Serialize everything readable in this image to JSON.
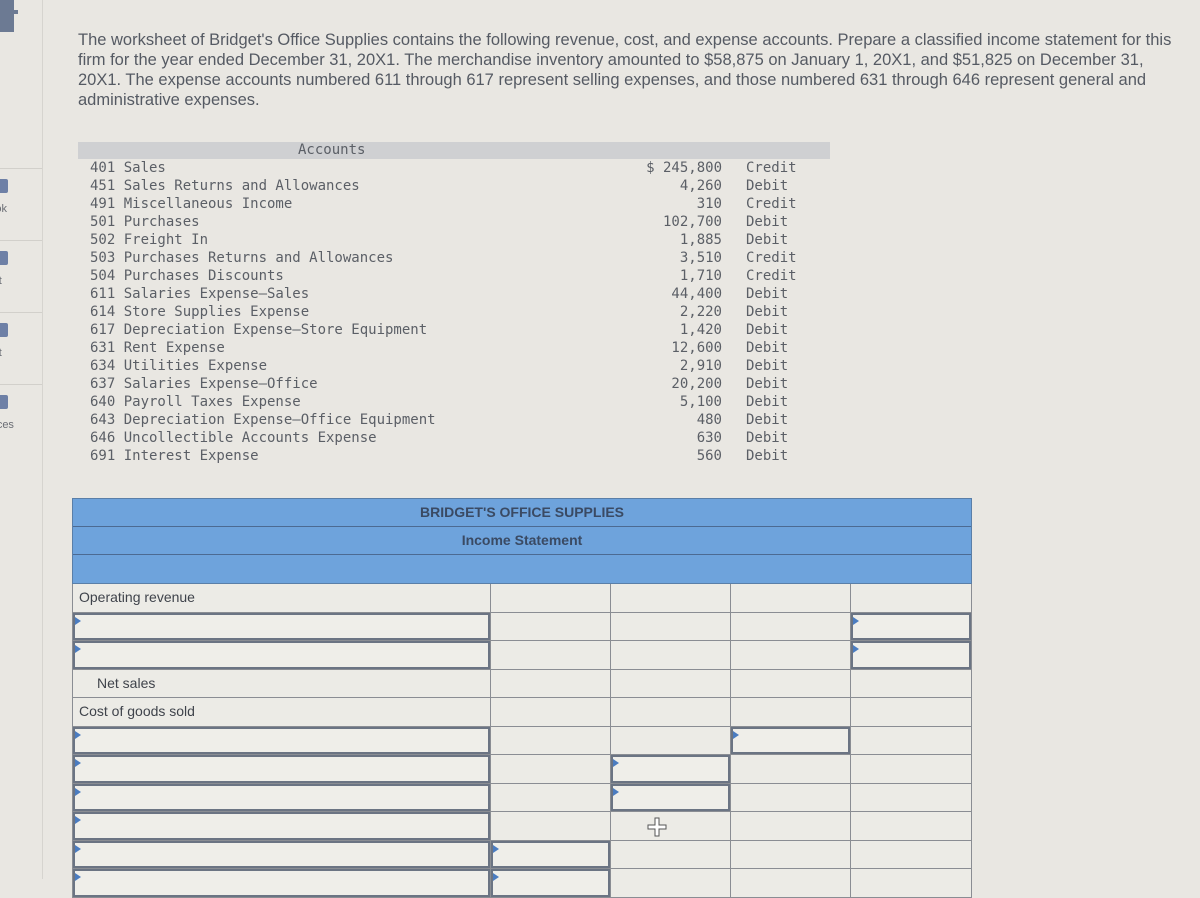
{
  "sidebar": {
    "items": [
      {
        "label": "ok",
        "icon": "book-icon"
      },
      {
        "label": "t",
        "icon": "print-icon"
      },
      {
        "label": "t",
        "icon": "hint-icon"
      },
      {
        "label": "nces",
        "icon": "references-icon"
      }
    ]
  },
  "prompt": "The worksheet of Bridget's Office Supplies contains the following revenue, cost, and expense accounts. Prepare a classified income statement for this firm for the year ended December 31, 20X1. The merchandise inventory amounted to $58,875 on January 1, 20X1, and $51,825 on December 31, 20X1. The expense accounts numbered 611 through 617 represent selling expenses, and those numbered 631 through 646 represent general and administrative expenses.",
  "accounts": {
    "header": "Accounts",
    "rows": [
      {
        "name": "401 Sales",
        "amount": "$ 245,800",
        "side": "Credit"
      },
      {
        "name": "451 Sales Returns and Allowances",
        "amount": "4,260",
        "side": "Debit"
      },
      {
        "name": "491 Miscellaneous Income",
        "amount": "310",
        "side": "Credit"
      },
      {
        "name": "501 Purchases",
        "amount": "102,700",
        "side": "Debit"
      },
      {
        "name": "502 Freight In",
        "amount": "1,885",
        "side": "Debit"
      },
      {
        "name": "503 Purchases Returns and Allowances",
        "amount": "3,510",
        "side": "Credit"
      },
      {
        "name": "504 Purchases Discounts",
        "amount": "1,710",
        "side": "Credit"
      },
      {
        "name": "611 Salaries Expense—Sales",
        "amount": "44,400",
        "side": "Debit"
      },
      {
        "name": "614 Store Supplies Expense",
        "amount": "2,220",
        "side": "Debit"
      },
      {
        "name": "617 Depreciation Expense—Store Equipment",
        "amount": "1,420",
        "side": "Debit"
      },
      {
        "name": "631 Rent Expense",
        "amount": "12,600",
        "side": "Debit"
      },
      {
        "name": "634 Utilities Expense",
        "amount": "2,910",
        "side": "Debit"
      },
      {
        "name": "637 Salaries Expense—Office",
        "amount": "20,200",
        "side": "Debit"
      },
      {
        "name": "640 Payroll Taxes Expense",
        "amount": "5,100",
        "side": "Debit"
      },
      {
        "name": "643 Depreciation Expense—Office Equipment",
        "amount": "480",
        "side": "Debit"
      },
      {
        "name": "646 Uncollectible Accounts Expense",
        "amount": "630",
        "side": "Debit"
      },
      {
        "name": "691 Interest Expense",
        "amount": "560",
        "side": "Debit"
      }
    ]
  },
  "statement": {
    "company": "BRIDGET'S OFFICE SUPPLIES",
    "title": "Income Statement",
    "period": "",
    "rows": [
      {
        "label": "Operating revenue",
        "indent": false,
        "label_input": false,
        "inputs": []
      },
      {
        "label": "",
        "indent": false,
        "label_input": true,
        "inputs": [
          4
        ]
      },
      {
        "label": "",
        "indent": false,
        "label_input": true,
        "inputs": [
          4
        ]
      },
      {
        "label": "Net sales",
        "indent": true,
        "label_input": false,
        "inputs": []
      },
      {
        "label": "Cost of goods sold",
        "indent": false,
        "label_input": false,
        "inputs": []
      },
      {
        "label": "",
        "indent": false,
        "label_input": true,
        "inputs": [
          3
        ]
      },
      {
        "label": "",
        "indent": false,
        "label_input": true,
        "inputs": [
          2
        ]
      },
      {
        "label": "",
        "indent": false,
        "label_input": true,
        "inputs": [
          2
        ]
      },
      {
        "label": "",
        "indent": false,
        "label_input": true,
        "inputs": []
      },
      {
        "label": "",
        "indent": false,
        "label_input": true,
        "inputs": [
          1
        ]
      },
      {
        "label": "",
        "indent": false,
        "label_input": true,
        "inputs": [
          1
        ]
      }
    ]
  }
}
